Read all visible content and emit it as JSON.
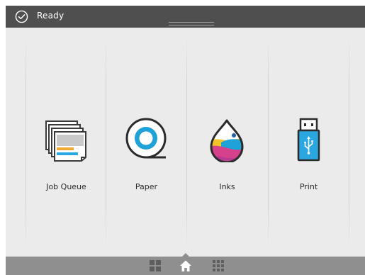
{
  "status": {
    "text": "Ready",
    "icon": "check-circle-icon"
  },
  "tiles": [
    {
      "label": "Job Queue",
      "icon": "job-queue-icon"
    },
    {
      "label": "Paper",
      "icon": "paper-roll-icon"
    },
    {
      "label": "Inks",
      "icon": "ink-drop-icon"
    },
    {
      "label": "Print",
      "icon": "usb-drive-icon"
    }
  ],
  "bottom_nav": {
    "items": [
      "widgets-icon",
      "home-icon",
      "apps-grid-icon"
    ],
    "active": "home-icon"
  },
  "colors": {
    "status_bar": "#4f4f4f",
    "background": "#ebebeb",
    "bottom_bar": "#8f8f8f",
    "usb_blue": "#2aa7e0",
    "ink_pink": "#d6418c",
    "ink_yellow": "#f2c32c",
    "ink_cyan": "#1fa2d8"
  }
}
